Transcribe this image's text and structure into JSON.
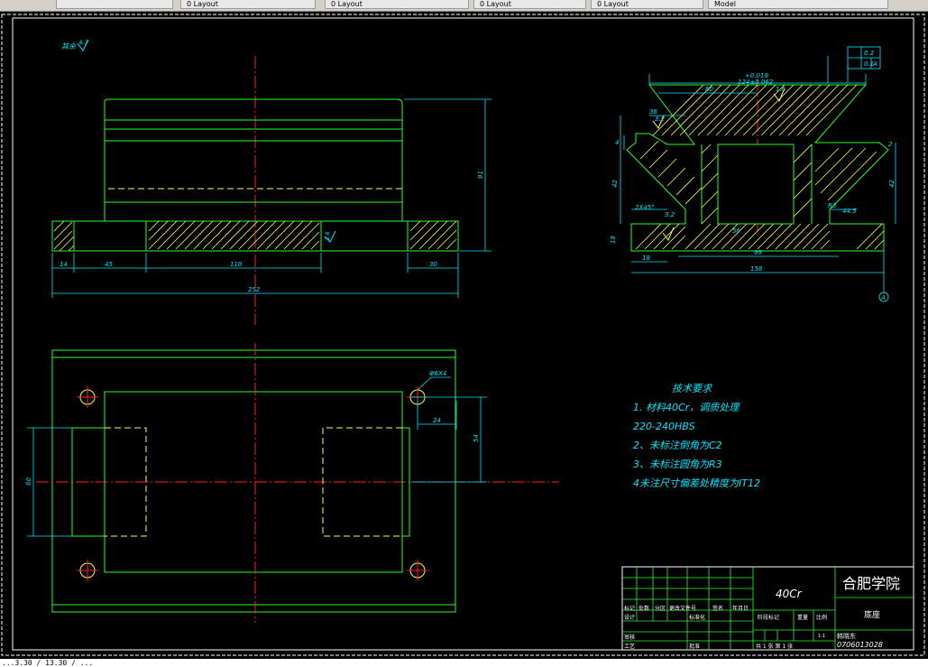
{
  "toolbar": {
    "tabs": [
      "",
      "0 Layout",
      "0 Layout",
      "0 Layout",
      "0 Layout",
      "Model"
    ]
  },
  "status": {
    "coords": "...3.30 / 13.30 / ..."
  },
  "drawing": {
    "surface_finish_note": "其余",
    "finish_value": "6.3",
    "front_view": {
      "dims": {
        "d14": "14",
        "d45": "45",
        "d110": "110",
        "d30": "30",
        "d252": "252",
        "d91": "91",
        "ra": "1.6"
      }
    },
    "section_view": {
      "dims": {
        "tol_upper": "+0.018",
        "tol_main": "124±0.062",
        "d60": "60",
        "ra_top": "1.6",
        "d36": "36",
        "ra_left": "3.2",
        "d4": "4",
        "d42_left": "42",
        "chamfer": "2X45°",
        "ra_mid": "3.2",
        "d18": "18",
        "d18b": "18",
        "d56": "56",
        "d99": "99",
        "d158": "158",
        "r3": "R3",
        "d44": "44.5",
        "d42_right": "42",
        "d2": "2",
        "gtol_1": "0.2",
        "gtol_2": "0.1",
        "gtol_ref": "A",
        "datum": "A"
      }
    },
    "plan_view": {
      "dims": {
        "hole": "Φ6X4",
        "d24": "24",
        "d54": "54",
        "d60": "60"
      }
    },
    "tech_requirements": {
      "title": "技术要求",
      "lines": [
        "1. 材料40Cr，调质处理",
        "220-240HBS",
        "2、未标注倒角为C2",
        "3、未标注圆角为R3",
        "4未注尺寸偏差处精度为IT12"
      ]
    },
    "title_block": {
      "material": "40Cr",
      "school": "合肥学院",
      "part_name": "底座",
      "author": "韩晓东",
      "number": "0706013028",
      "headers": [
        "标记",
        "处数",
        "分区",
        "更改文件号",
        "签名",
        "年月日"
      ],
      "row_design": "设计",
      "row_standard": "标准化",
      "row_audit": "审核",
      "row_process": "工艺",
      "row_approve": "批准",
      "stage": "阶段标记",
      "weight": "重量",
      "scale": "比例",
      "scale_value": "1:1",
      "sheets": "共 1 张 第 1 张"
    }
  }
}
